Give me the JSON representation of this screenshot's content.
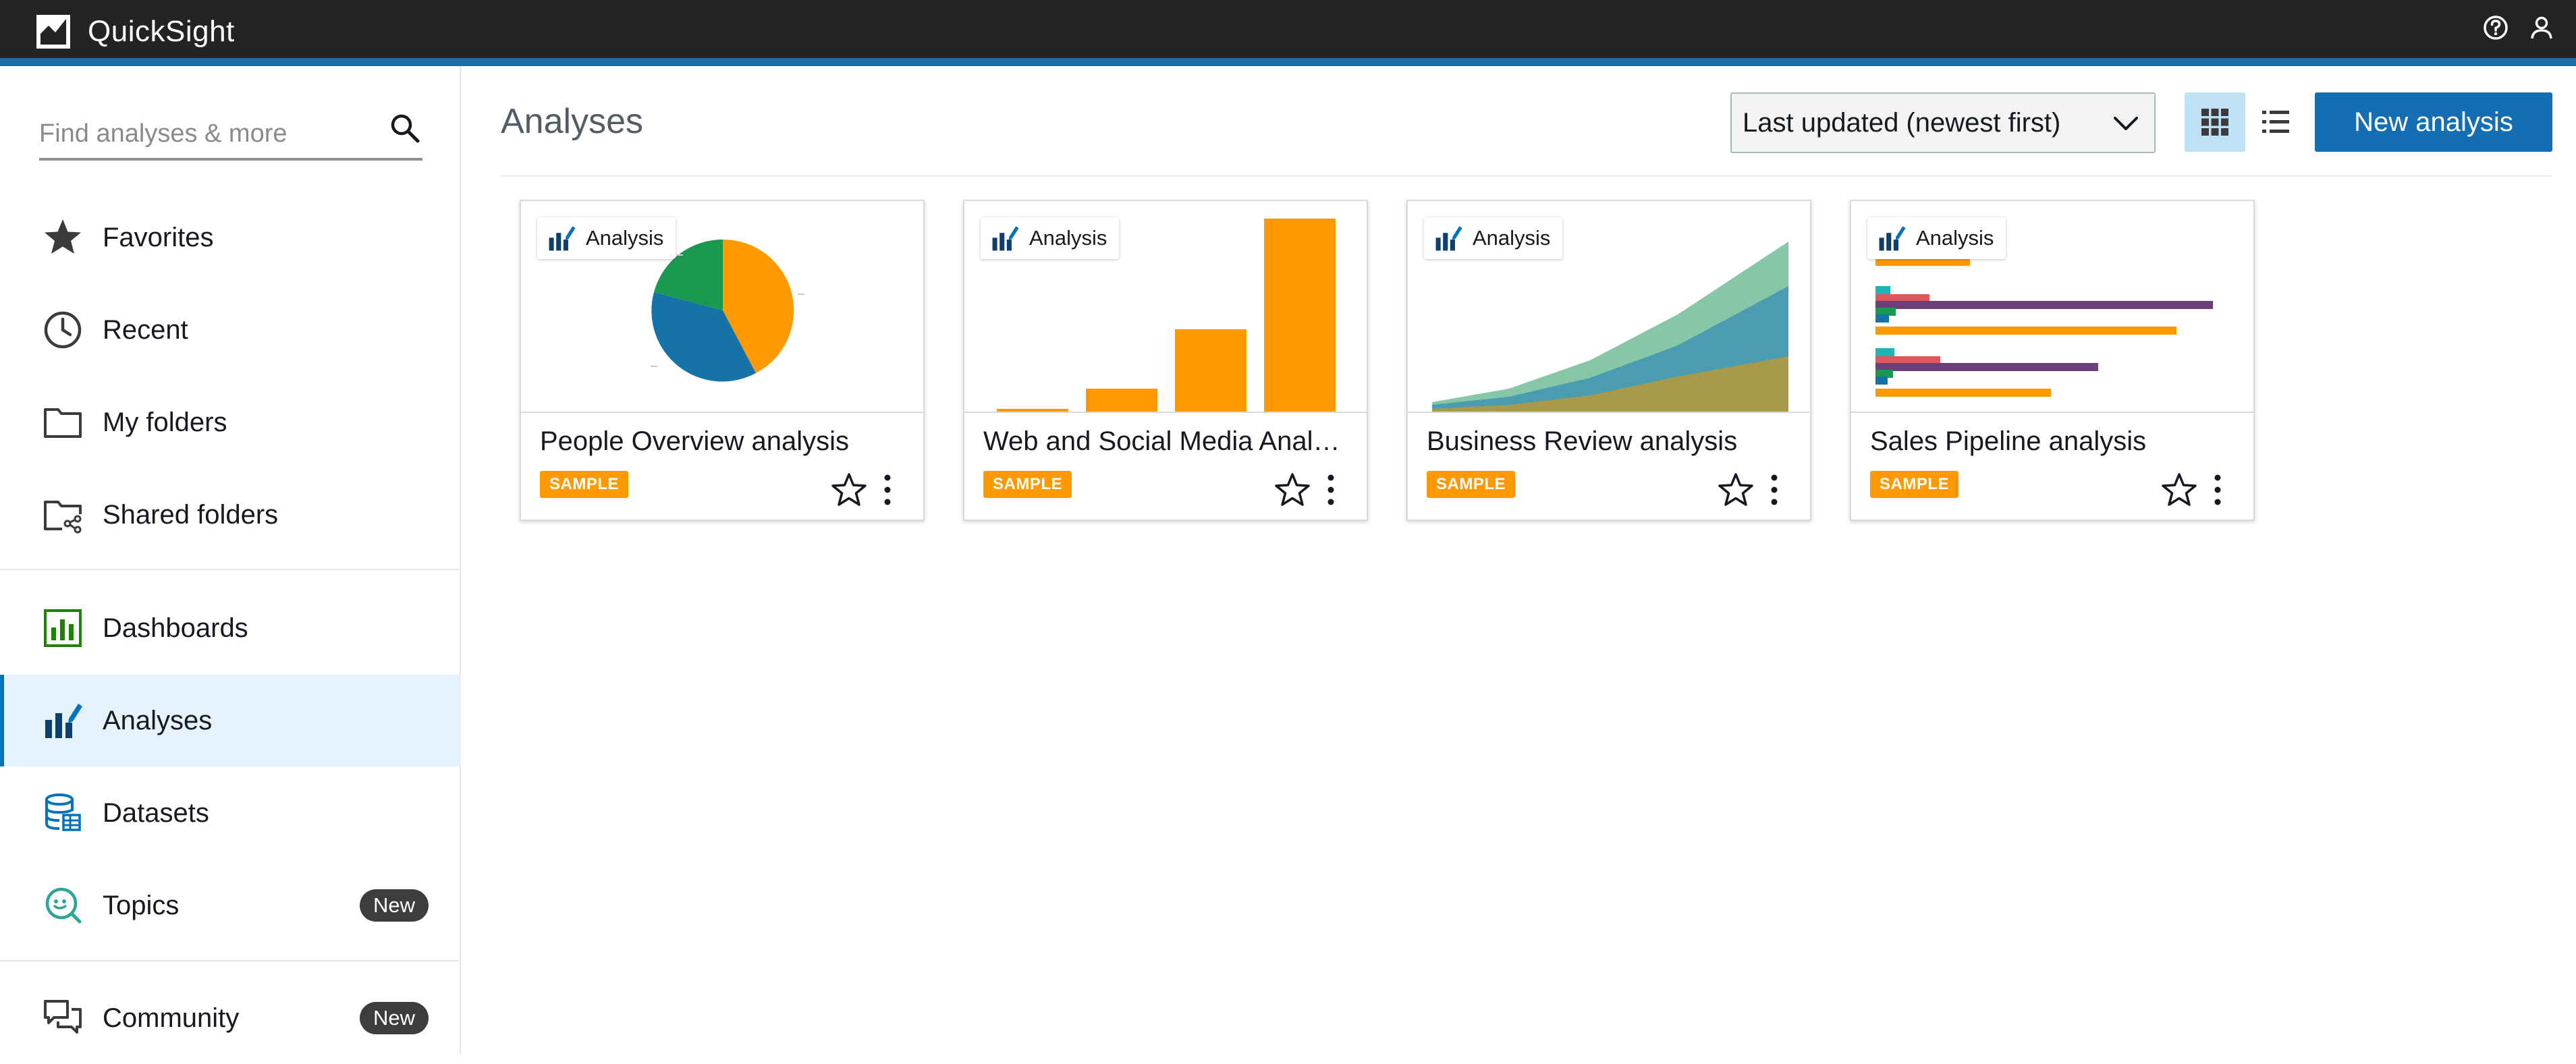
{
  "app": {
    "name": "QuickSight",
    "top_icons": [
      "help-icon",
      "user-icon"
    ]
  },
  "sidebar": {
    "search_placeholder": "Find analyses & more",
    "items": [
      {
        "label": "Favorites",
        "icon": "star-icon"
      },
      {
        "label": "Recent",
        "icon": "clock-icon"
      },
      {
        "label": "My folders",
        "icon": "folder-icon"
      },
      {
        "label": "Shared folders",
        "icon": "shared-folder-icon"
      },
      {
        "label": "Dashboards",
        "icon": "dashboard-icon"
      },
      {
        "label": "Analyses",
        "icon": "analysis-icon",
        "active": true
      },
      {
        "label": "Datasets",
        "icon": "dataset-icon"
      },
      {
        "label": "Topics",
        "icon": "topic-icon",
        "badge": "New"
      },
      {
        "label": "Community",
        "icon": "community-icon",
        "badge": "New"
      }
    ]
  },
  "main": {
    "title": "Analyses",
    "sort": {
      "selected": "Last updated (newest first)"
    },
    "view_modes": [
      "grid",
      "list"
    ],
    "active_view": "grid",
    "new_button_label": "New analysis",
    "cards": [
      {
        "type_label": "Analysis",
        "title": "People Overview analysis",
        "badge": "SAMPLE",
        "thumbnail": "pie-chart"
      },
      {
        "type_label": "Analysis",
        "title": "Web and Social Media Anal…",
        "badge": "SAMPLE",
        "thumbnail": "bar-chart"
      },
      {
        "type_label": "Analysis",
        "title": "Business Review analysis",
        "badge": "SAMPLE",
        "thumbnail": "area-chart"
      },
      {
        "type_label": "Analysis",
        "title": "Sales Pipeline analysis",
        "badge": "SAMPLE",
        "thumbnail": "horizontal-bar-chart"
      }
    ]
  },
  "colors": {
    "topbar": "#232323",
    "accent_strip": "#1b6fa8",
    "primary_button": "#146eb4",
    "active_nav_bg": "#e5f2fb",
    "sample_badge": "#ff9900",
    "chart_orange": "#ff9900",
    "chart_blue": "#1f77b4",
    "chart_green": "#1a9850",
    "chart_teal": "#1fb5b5",
    "chart_red": "#e15759",
    "chart_purple": "#6d3f7a"
  }
}
